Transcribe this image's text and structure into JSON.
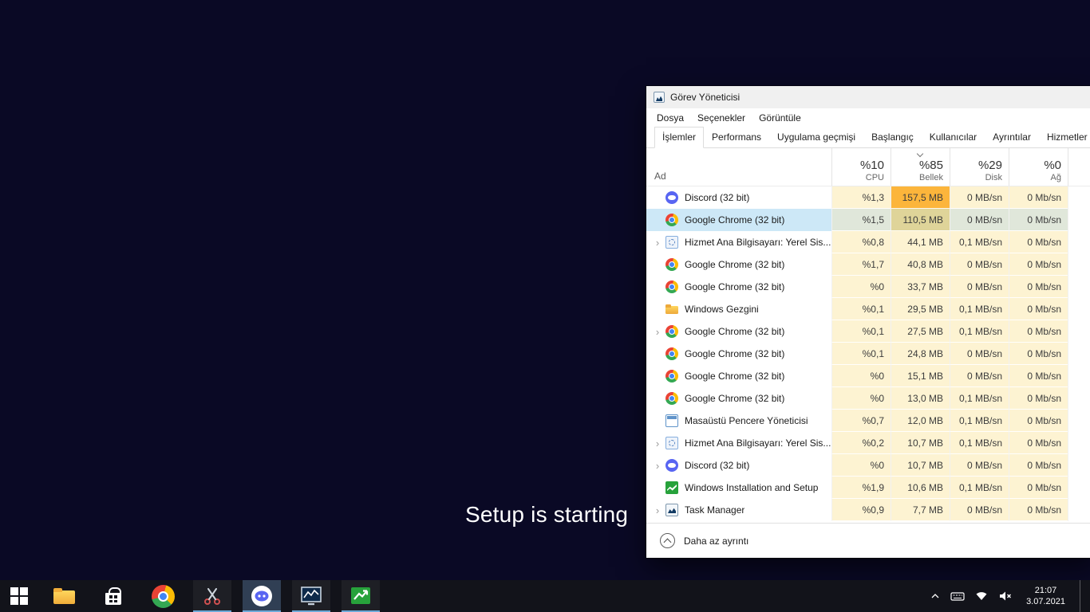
{
  "desktop": {
    "setup_text": "Setup is starting"
  },
  "colors": {
    "desktop_bg": "#0a0925",
    "taskbar_bg": "#12131a",
    "selection_blue": "#cde8f7",
    "heat_low": "#fdf3d2",
    "heat_mid": "#fbd978",
    "heat_high": "#fcb53b",
    "discord_blue": "#5865f2",
    "chrome_blue": "#4285f4",
    "setup_green": "#27a23b"
  },
  "window": {
    "title": "Görev Yöneticisi",
    "menu": [
      "Dosya",
      "Seçenekler",
      "Görüntüle"
    ],
    "tabs": [
      "İşlemler",
      "Performans",
      "Uygulama geçmişi",
      "Başlangıç",
      "Kullanıcılar",
      "Ayrıntılar",
      "Hizmetler"
    ],
    "active_tab_index": 0,
    "header": {
      "name_col": "Ad",
      "value_cols": [
        {
          "pct": "%10",
          "label": "CPU",
          "sorted": false
        },
        {
          "pct": "%85",
          "label": "Bellek",
          "sorted": true
        },
        {
          "pct": "%29",
          "label": "Disk",
          "sorted": false
        },
        {
          "pct": "%0",
          "label": "Ağ",
          "sorted": false
        }
      ]
    },
    "processes": [
      {
        "name": "Discord (32 bit)",
        "icon": "discord",
        "expand": false,
        "selected": false,
        "cpu": "%1,3",
        "mem": "157,5 MB",
        "disk": "0 MB/sn",
        "net": "0 Mb/sn",
        "mem_heat": 3
      },
      {
        "name": "Google Chrome (32 bit)",
        "icon": "chrome",
        "expand": false,
        "selected": true,
        "cpu": "%1,5",
        "mem": "110,5 MB",
        "disk": "0 MB/sn",
        "net": "0 Mb/sn",
        "mem_heat": 2
      },
      {
        "name": "Hizmet Ana Bilgisayarı: Yerel Sis...",
        "icon": "service",
        "expand": true,
        "selected": false,
        "cpu": "%0,8",
        "mem": "44,1 MB",
        "disk": "0,1 MB/sn",
        "net": "0 Mb/sn",
        "mem_heat": 1
      },
      {
        "name": "Google Chrome (32 bit)",
        "icon": "chrome",
        "expand": false,
        "selected": false,
        "cpu": "%1,7",
        "mem": "40,8 MB",
        "disk": "0 MB/sn",
        "net": "0 Mb/sn",
        "mem_heat": 1
      },
      {
        "name": "Google Chrome (32 bit)",
        "icon": "chrome",
        "expand": false,
        "selected": false,
        "cpu": "%0",
        "mem": "33,7 MB",
        "disk": "0 MB/sn",
        "net": "0 Mb/sn",
        "mem_heat": 1
      },
      {
        "name": "Windows Gezgini",
        "icon": "folder",
        "expand": false,
        "selected": false,
        "cpu": "%0,1",
        "mem": "29,5 MB",
        "disk": "0,1 MB/sn",
        "net": "0 Mb/sn",
        "mem_heat": 1
      },
      {
        "name": "Google Chrome (32 bit)",
        "icon": "chrome",
        "expand": true,
        "selected": false,
        "cpu": "%0,1",
        "mem": "27,5 MB",
        "disk": "0,1 MB/sn",
        "net": "0 Mb/sn",
        "mem_heat": 1
      },
      {
        "name": "Google Chrome (32 bit)",
        "icon": "chrome",
        "expand": false,
        "selected": false,
        "cpu": "%0,1",
        "mem": "24,8 MB",
        "disk": "0 MB/sn",
        "net": "0 Mb/sn",
        "mem_heat": 1
      },
      {
        "name": "Google Chrome (32 bit)",
        "icon": "chrome",
        "expand": false,
        "selected": false,
        "cpu": "%0",
        "mem": "15,1 MB",
        "disk": "0 MB/sn",
        "net": "0 Mb/sn",
        "mem_heat": 1
      },
      {
        "name": "Google Chrome (32 bit)",
        "icon": "chrome",
        "expand": false,
        "selected": false,
        "cpu": "%0",
        "mem": "13,0 MB",
        "disk": "0,1 MB/sn",
        "net": "0 Mb/sn",
        "mem_heat": 1
      },
      {
        "name": "Masaüstü Pencere Yöneticisi",
        "icon": "dwm",
        "expand": false,
        "selected": false,
        "cpu": "%0,7",
        "mem": "12,0 MB",
        "disk": "0,1 MB/sn",
        "net": "0 Mb/sn",
        "mem_heat": 1
      },
      {
        "name": "Hizmet Ana Bilgisayarı: Yerel Sis...",
        "icon": "service",
        "expand": true,
        "selected": false,
        "cpu": "%0,2",
        "mem": "10,7 MB",
        "disk": "0,1 MB/sn",
        "net": "0 Mb/sn",
        "mem_heat": 1
      },
      {
        "name": "Discord (32 bit)",
        "icon": "discord",
        "expand": true,
        "selected": false,
        "cpu": "%0",
        "mem": "10,7 MB",
        "disk": "0 MB/sn",
        "net": "0 Mb/sn",
        "mem_heat": 1
      },
      {
        "name": "Windows Installation and Setup",
        "icon": "setup",
        "expand": false,
        "selected": false,
        "cpu": "%1,9",
        "mem": "10,6 MB",
        "disk": "0,1 MB/sn",
        "net": "0 Mb/sn",
        "mem_heat": 1
      },
      {
        "name": "Task Manager",
        "icon": "taskmgr",
        "expand": true,
        "selected": false,
        "cpu": "%0,9",
        "mem": "7,7 MB",
        "disk": "0 MB/sn",
        "net": "0 Mb/sn",
        "mem_heat": 1
      }
    ],
    "footer_label": "Daha az ayrıntı"
  },
  "taskbar": {
    "apps": [
      {
        "id": "start",
        "icon": "windows-start-icon",
        "open": false,
        "active": false
      },
      {
        "id": "file-explorer",
        "icon": "file-explorer-icon",
        "open": false,
        "active": false
      },
      {
        "id": "microsoft-store",
        "icon": "store-icon",
        "open": false,
        "active": false
      },
      {
        "id": "chrome",
        "icon": "chrome-icon",
        "open": false,
        "active": false
      },
      {
        "id": "snipping-tool",
        "icon": "snipping-tool-icon",
        "open": true,
        "active": false
      },
      {
        "id": "discord",
        "icon": "discord-icon",
        "open": true,
        "active": true
      },
      {
        "id": "task-manager",
        "icon": "task-manager-icon",
        "open": true,
        "active": false
      },
      {
        "id": "setup-app",
        "icon": "setup-app-icon",
        "open": true,
        "active": false
      }
    ],
    "tray_icons": [
      "hidden-icons-chevron-icon",
      "touch-keyboard-icon",
      "network-icon",
      "volume-muted-icon"
    ],
    "clock": {
      "time": "21:07",
      "date": "3.07.2021"
    }
  }
}
